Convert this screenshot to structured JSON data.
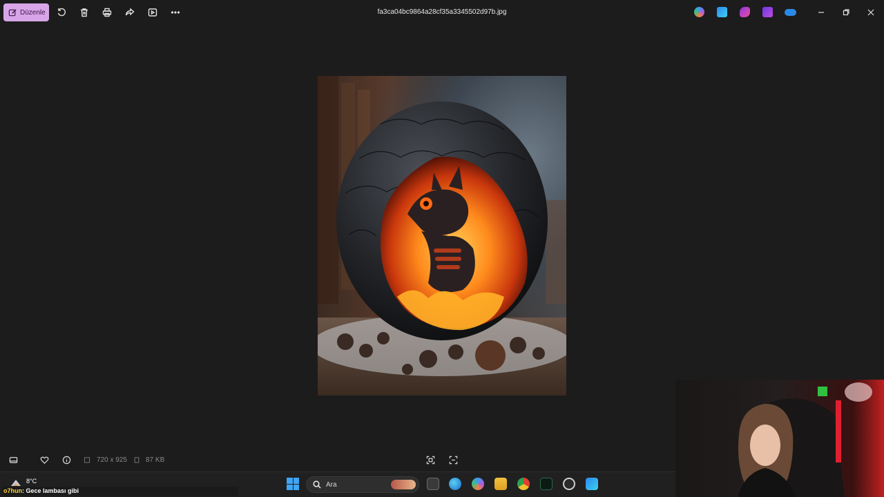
{
  "titlebar": {
    "edit_label": "Düzenle",
    "file_name": "fa3ca04bc9864a28cf35a3345502d97b.jpg",
    "tools": [
      "rotate-icon",
      "delete-icon",
      "print-icon",
      "share-icon",
      "slideshow-icon",
      "more-icon"
    ],
    "apps": [
      "copilot-icon",
      "paint-icon",
      "clipchamp-icon",
      "designer-icon",
      "onedrive-icon"
    ],
    "window_controls": [
      "minimize-icon",
      "restore-icon",
      "close-icon"
    ]
  },
  "photo": {
    "subject": "baby-dragon-in-cracked-lava-egg"
  },
  "infobar": {
    "dimensions": "720 x 925",
    "file_size": "87 KB"
  },
  "taskbar": {
    "temperature": "8°C",
    "search_placeholder": "Ara",
    "apps": [
      "task-view-icon",
      "edge-icon",
      "copilot-icon",
      "file-explorer-icon",
      "chrome-icon",
      "terminal-icon",
      "obs-icon",
      "photos-icon"
    ]
  },
  "chat": {
    "user": "o7hun",
    "message": ": Gece lambası gibi"
  },
  "colors": {
    "edit_button": "#d8a6e8",
    "background": "#1c1c1c",
    "accent_blue": "#3fa5f5"
  }
}
